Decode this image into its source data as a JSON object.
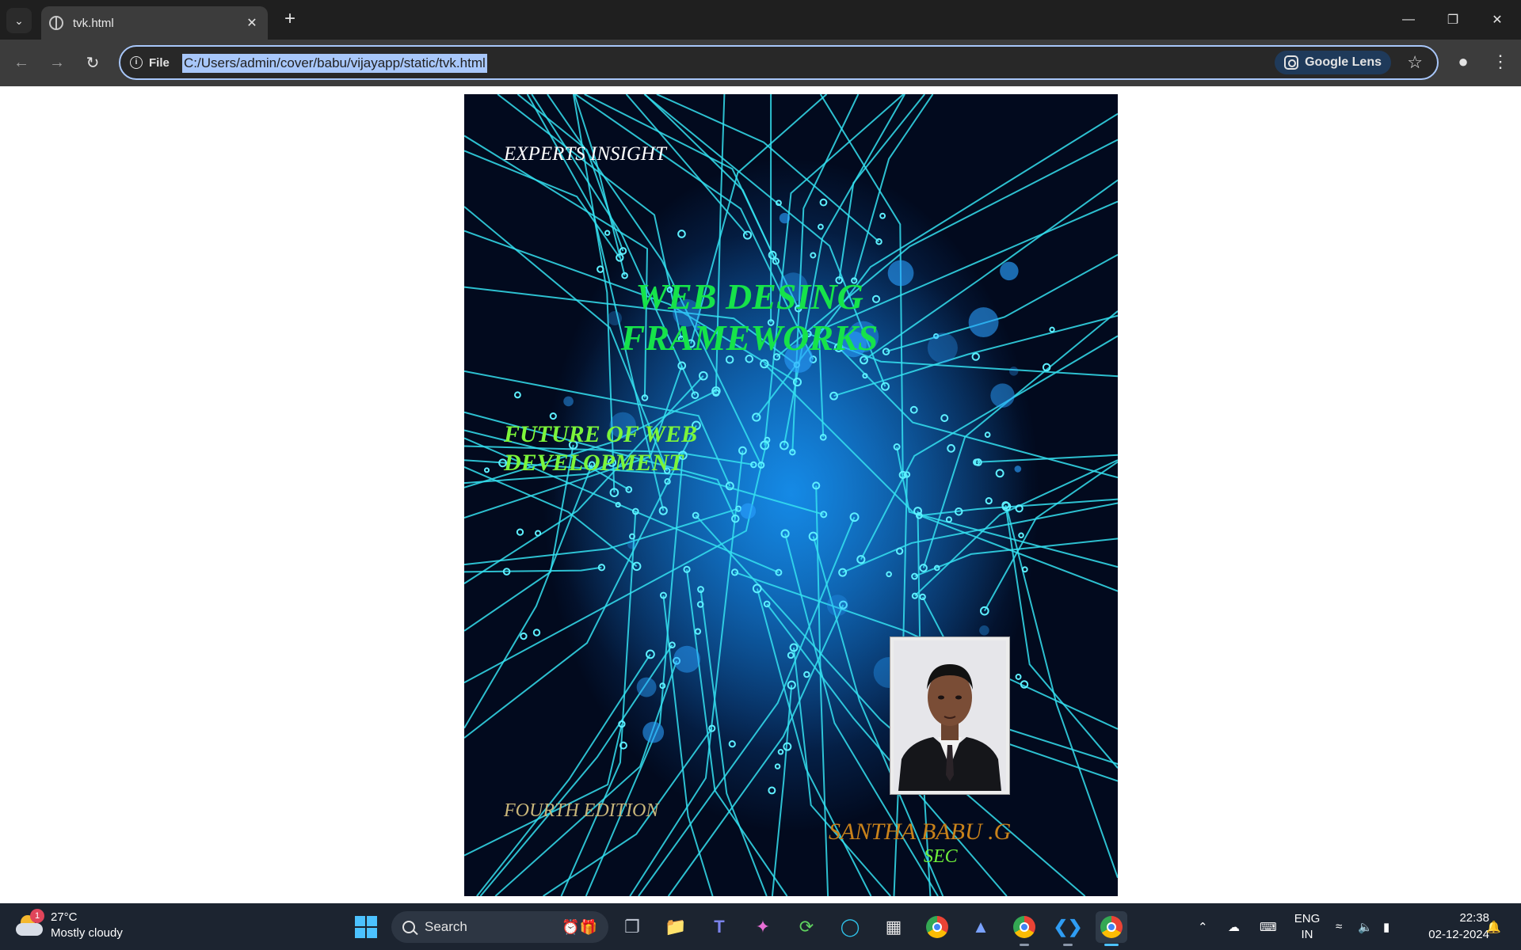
{
  "browser": {
    "tab_title": "tvk.html",
    "new_tab_label": "+",
    "address_scheme_label": "File",
    "address_url": "C:/Users/admin/cover/babu/vijayapp/static/tvk.html",
    "lens_label": "Google Lens"
  },
  "cover": {
    "series_label": "EXPERTS INSIGHT",
    "title_line1": "WEB DESING",
    "title_line2": "FRAMEWORKS",
    "subtitle_line1": "FUTURE OF WEB",
    "subtitle_line2": "DEVELOPMENT",
    "edition": "FOURTH EDITION",
    "author": "SANTHA BABU .G",
    "college": "SEC",
    "colors": {
      "title": "#16e34a",
      "subtitle": "#7cf53a",
      "edition": "#c9b67a",
      "author": "#c9821a",
      "college": "#6ff13a",
      "circuit": "#35e0f0"
    }
  },
  "taskbar": {
    "weather_temp": "27°C",
    "weather_desc": "Mostly cloudy",
    "weather_badge": "1",
    "search_placeholder": "Search",
    "lang_line1": "ENG",
    "lang_line2": "IN",
    "time": "22:38",
    "date": "02-12-2024",
    "apps": [
      "start-icon",
      "task-view-icon",
      "file-explorer-icon",
      "teams-icon",
      "copilot-icon",
      "refresh-app-icon",
      "edge-icon",
      "store-icon",
      "chrome-icon",
      "app-icon",
      "chrome-profile-icon",
      "vscode-icon",
      "chrome-active-icon"
    ]
  }
}
